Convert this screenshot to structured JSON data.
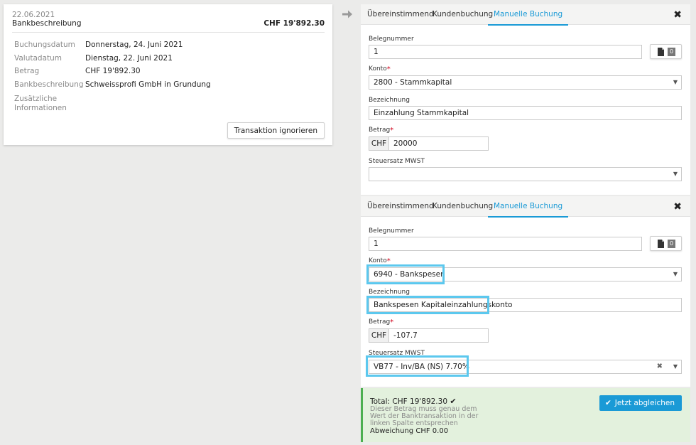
{
  "transaction": {
    "date": "22.06.2021",
    "title": "Bankbeschreibung",
    "amount": "CHF 19'892.30",
    "rows": [
      {
        "label": "Buchungsdatum",
        "value": "Donnerstag, 24. Juni 2021"
      },
      {
        "label": "Valutadatum",
        "value": "Dienstag, 22. Juni 2021"
      },
      {
        "label": "Betrag",
        "value": "CHF 19'892.30"
      },
      {
        "label": "Bankbeschreibung",
        "value": "Schweissprofi GmbH in Grundung"
      },
      {
        "label": "Zusätzliche Informationen",
        "value": ""
      }
    ],
    "ignore_button": "Transaktion ignorieren"
  },
  "tabs": [
    "Übereinstimmend",
    "Kundenbuchung",
    "Manuelle Buchung"
  ],
  "bookings": [
    {
      "beleg_label": "Belegnummer",
      "beleg_value": "1",
      "doc_count": "0",
      "konto_label": "Konto",
      "konto_value": "2800 - Stammkapital",
      "bezeichnung_label": "Bezeichnung",
      "bezeichnung_value": "Einzahlung Stammkapital",
      "betrag_label": "Betrag",
      "currency": "CHF",
      "betrag_value": "20000",
      "mwst_label": "Steuersatz MWST",
      "mwst_value": ""
    },
    {
      "beleg_label": "Belegnummer",
      "beleg_value": "1",
      "doc_count": "0",
      "konto_label": "Konto",
      "konto_value": "6940 - Bankspesen",
      "bezeichnung_label": "Bezeichnung",
      "bezeichnung_value": "Bankspesen Kapitaleinzahlungskonto",
      "betrag_label": "Betrag",
      "currency": "CHF",
      "betrag_value": "-107.7",
      "mwst_label": "Steuersatz MWST",
      "mwst_value": "VB77 - Inv/BA (NS) 7.70%"
    }
  ],
  "summary": {
    "total_label": "Total:",
    "total_value": "CHF  19'892.30",
    "note": "Dieser Betrag muss genau dem Wert der Banktransaktion in der linken Spalte entsprechen",
    "diff_label": "Abweichung",
    "diff_value": "CHF  0.00",
    "button": "Jetzt abgleichen"
  },
  "colors": {
    "accent": "#1a9ad6",
    "highlight": "#5cc8ee",
    "success_bg": "#e3f1dd"
  }
}
